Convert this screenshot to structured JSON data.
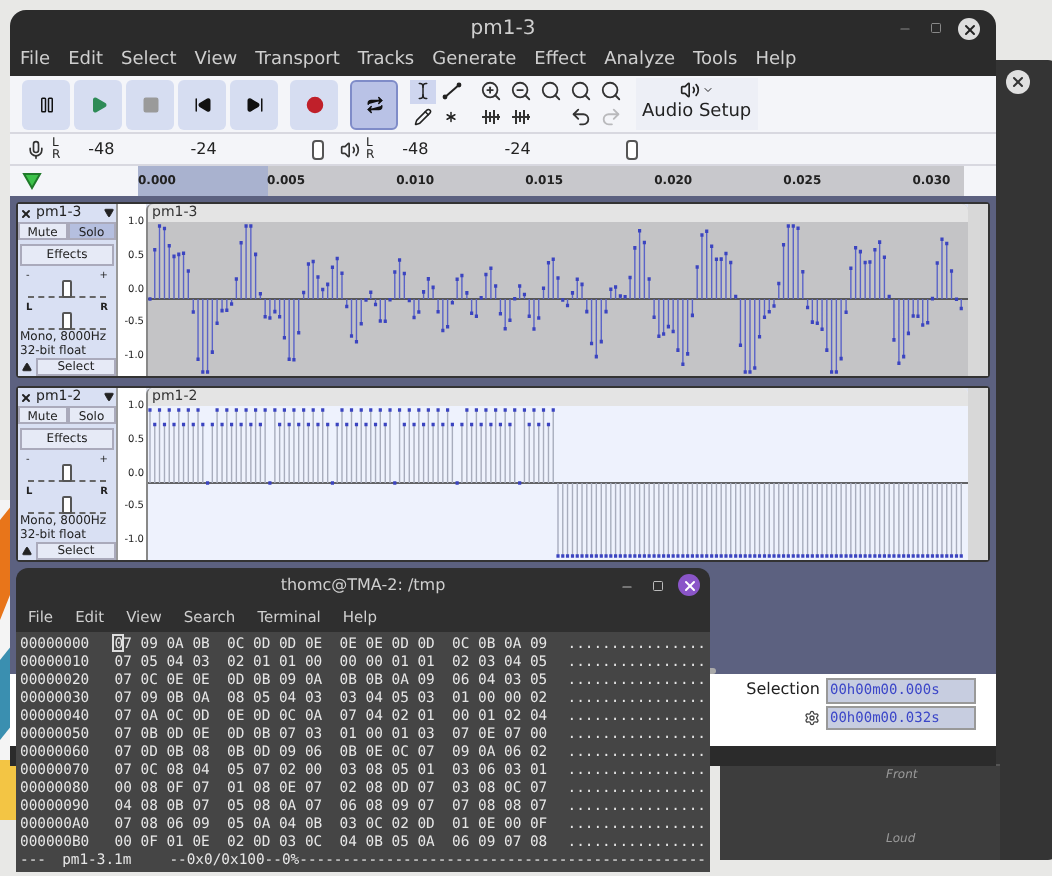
{
  "audacity": {
    "title": "pm1-3",
    "menu": [
      "File",
      "Edit",
      "Select",
      "View",
      "Transport",
      "Tracks",
      "Generate",
      "Effect",
      "Analyze",
      "Tools",
      "Help"
    ],
    "transport": [
      {
        "kind": "pause",
        "selected": false
      },
      {
        "kind": "play",
        "selected": false
      },
      {
        "kind": "stop",
        "selected": false
      },
      {
        "kind": "skip_start",
        "selected": false
      },
      {
        "kind": "skip_end",
        "selected": false
      },
      {
        "kind": "record",
        "selected": false
      },
      {
        "kind": "loop",
        "selected": true
      }
    ],
    "tools": [
      {
        "kind": "select",
        "selected": true
      },
      {
        "kind": "envelope",
        "selected": false
      },
      {
        "kind": "draw",
        "selected": false
      },
      {
        "kind": "multi",
        "selected": false
      }
    ],
    "edit_buttons": [
      {
        "kind": "zoom_in",
        "disabled": false
      },
      {
        "kind": "zoom_out",
        "disabled": false
      },
      {
        "kind": "fit_selection",
        "disabled": false
      },
      {
        "kind": "fit_project",
        "disabled": false
      },
      {
        "kind": "zoom_toggle",
        "disabled": false
      },
      {
        "kind": "trim",
        "disabled": false
      },
      {
        "kind": "silence",
        "disabled": false
      },
      {
        "kind": "undo",
        "disabled": false
      },
      {
        "kind": "redo",
        "disabled": true
      }
    ],
    "audio_setup": "Audio Setup",
    "meters": [
      {
        "kind": "record",
        "channels": [
          "L",
          "R"
        ],
        "ticks": [
          "-48",
          "-24"
        ]
      },
      {
        "kind": "play",
        "channels": [
          "L",
          "R"
        ],
        "ticks": [
          "-48",
          "-24"
        ]
      }
    ],
    "timeline": [
      {
        "label": "0.000",
        "selected": true
      },
      {
        "label": "0.005",
        "selected": true
      },
      {
        "label": "0.010",
        "selected": false
      },
      {
        "label": "0.015",
        "selected": false
      },
      {
        "label": "0.020",
        "selected": false
      },
      {
        "label": "0.025",
        "selected": false
      },
      {
        "label": "0.030",
        "selected": false
      }
    ],
    "tracks": [
      {
        "name": "pm1-3",
        "selected": true,
        "buttons": [
          {
            "label": "Mute",
            "on": false
          },
          {
            "label": "Solo",
            "on": true
          }
        ],
        "effects": "Effects",
        "gain": {
          "labels": [
            "-",
            "+"
          ],
          "level": 0.5
        },
        "pan": {
          "labels": [
            "L",
            "R"
          ],
          "level": 0.5
        },
        "info": [
          "Mono, 8000Hz",
          "32-bit float"
        ],
        "select": "Select",
        "clip": "pm1-3",
        "y_ticks": [
          "1.0",
          "0.5",
          "0.0",
          "-0.5",
          "-1.0"
        ],
        "kind": "mixed"
      },
      {
        "name": "pm1-2",
        "selected": false,
        "buttons": [
          {
            "label": "Mute",
            "on": false
          },
          {
            "label": "Solo",
            "on": false
          }
        ],
        "effects": "Effects",
        "gain": {
          "labels": [
            "-",
            "+"
          ],
          "level": 0.5
        },
        "pan": {
          "labels": [
            "L",
            "R"
          ],
          "level": 0.5
        },
        "info": [
          "Mono, 8000Hz",
          "32-bit float"
        ],
        "select": "Select",
        "clip": "pm1-2",
        "y_ticks": [
          "1.0",
          "0.5",
          "0.0",
          "-0.5",
          "-1.0"
        ],
        "kind": "pulse"
      }
    ],
    "selection": {
      "label": "Selection",
      "start": "00h00m00.000s",
      "end": "00h00m00.032s"
    }
  },
  "terminal": {
    "title": "thomc@TMA-2: /tmp",
    "menu": [
      "File",
      "Edit",
      "View",
      "Search",
      "Terminal",
      "Help"
    ],
    "rows": [
      {
        "address": "00000000",
        "bytes": "07 09 0A 0B  0C 0D 0D 0E  0E 0E 0D 0D  0C 0B 0A 09",
        "ascii": "................"
      },
      {
        "address": "00000010",
        "bytes": "07 05 04 03  02 01 01 00  00 00 01 01  02 03 04 05",
        "ascii": "................"
      },
      {
        "address": "00000020",
        "bytes": "07 0C 0E 0E  0D 0B 09 0A  0B 0B 0A 09  06 04 03 05",
        "ascii": "................"
      },
      {
        "address": "00000030",
        "bytes": "07 09 0B 0A  08 05 04 03  03 04 05 03  01 00 00 02",
        "ascii": "................"
      },
      {
        "address": "00000040",
        "bytes": "07 0A 0C 0D  0E 0D 0C 0A  07 04 02 01  00 01 02 04",
        "ascii": "................"
      },
      {
        "address": "00000050",
        "bytes": "07 0B 0D 0E  0D 0B 07 03  01 00 01 03  07 0E 07 00",
        "ascii": "................"
      },
      {
        "address": "00000060",
        "bytes": "07 0D 0B 08  0B 0D 09 06  0B 0E 0C 07  09 0A 06 02",
        "ascii": "................"
      },
      {
        "address": "00000070",
        "bytes": "07 0C 08 04  05 07 02 00  03 08 05 01  03 06 03 01",
        "ascii": "................"
      },
      {
        "address": "00000080",
        "bytes": "00 08 0F 07  01 08 0E 07  02 08 0D 07  03 08 0C 07",
        "ascii": "................"
      },
      {
        "address": "00000090",
        "bytes": "04 08 0B 07  05 08 0A 07  06 08 09 07  07 08 08 07",
        "ascii": "................"
      },
      {
        "address": "000000A0",
        "bytes": "07 08 06 09  05 0A 04 0B  03 0C 02 0D  01 0E 00 0F",
        "ascii": "................"
      },
      {
        "address": "000000B0",
        "bytes": "00 0F 01 0E  02 0D 03 0C  04 0B 05 0A  06 09 07 08",
        "ascii": "................"
      }
    ],
    "status": [
      "---",
      "pm1-3.1m",
      "--0x0/0x100--0%-----------------------------------------------"
    ]
  },
  "background_window": {
    "labels": [
      "Front",
      "Loud"
    ]
  }
}
